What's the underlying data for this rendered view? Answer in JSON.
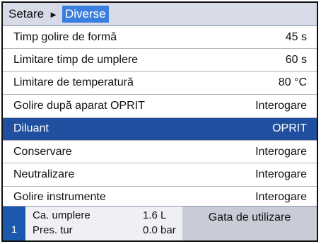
{
  "breadcrumb": {
    "parent": "Setare",
    "separator": "►",
    "current": "Diverse"
  },
  "menu": [
    {
      "label": "Timp golire de formă",
      "value": "45 s",
      "selected": false
    },
    {
      "label": "Limitare timp de umplere",
      "value": "60 s",
      "selected": false
    },
    {
      "label": "Limitare de temperatură",
      "value": "80 °C",
      "selected": false
    },
    {
      "label": "Golire după aparat OPRIT",
      "value": "Interogare",
      "selected": false
    },
    {
      "label": "Diluant",
      "value": "OPRIT",
      "selected": true
    },
    {
      "label": "Conservare",
      "value": "Interogare",
      "selected": false
    },
    {
      "label": "Neutralizare",
      "value": "Interogare",
      "selected": false
    },
    {
      "label": "Golire instrumente",
      "value": "Interogare",
      "selected": false
    }
  ],
  "status": {
    "unit_number": "1",
    "fill_label": "Ca. umplere",
    "fill_value": "1.6 L",
    "pressure_label": "Pres. tur",
    "pressure_value": "0.0 bar",
    "ready_text": "Gata de utilizare"
  },
  "colors": {
    "selected_row": "#1f4f9e",
    "breadcrumb_highlight": "#3a7fe0",
    "unit_badge": "#1c58ae"
  }
}
